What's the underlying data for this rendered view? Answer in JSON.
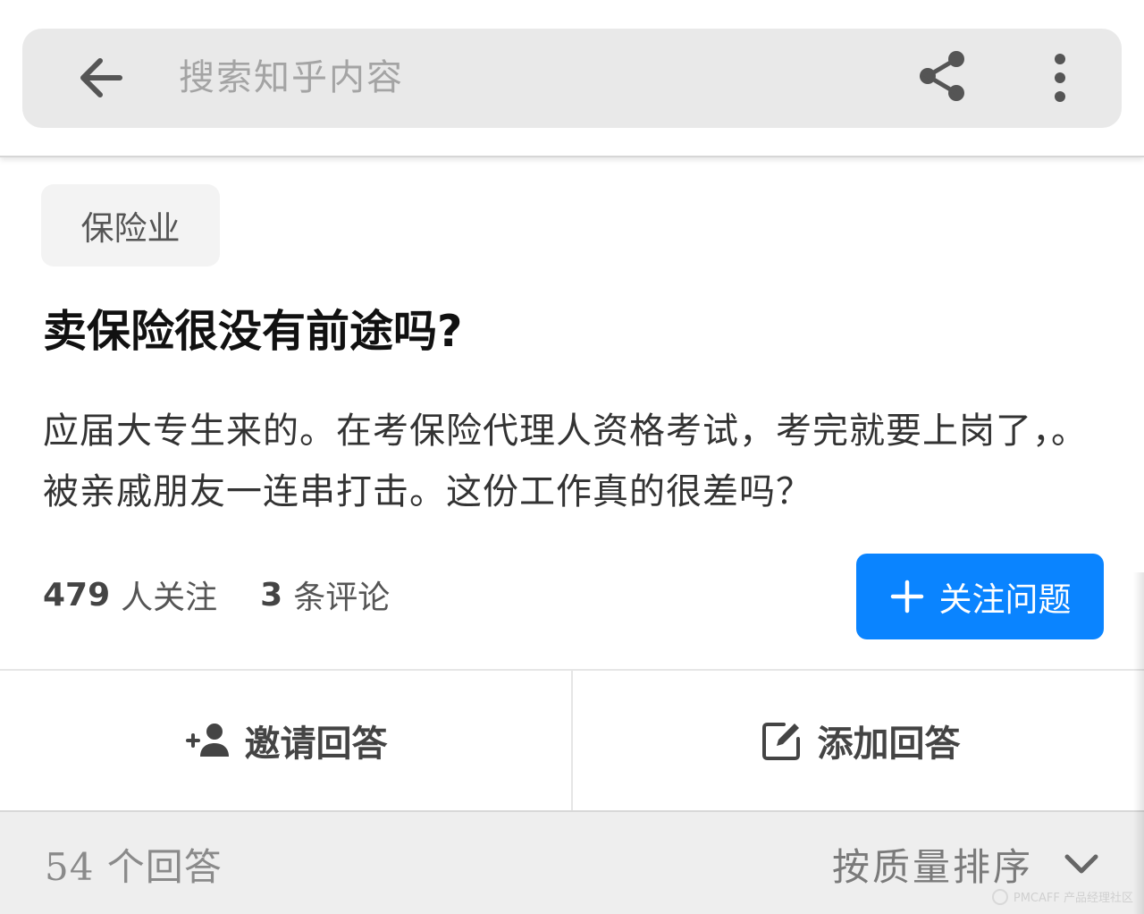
{
  "search": {
    "placeholder": "搜索知乎内容"
  },
  "icons": {
    "back": "arrow-back-icon",
    "share": "share-icon",
    "more": "more-vertical-icon",
    "follow": "plus-icon",
    "invite": "person-add-icon",
    "add_answer": "edit-icon",
    "sort": "chevron-down-icon"
  },
  "question": {
    "topic": "保险业",
    "title": "卖保险很没有前途吗?",
    "detail": "应届大专生来的。在考保险代理人资格考试，考完就要上岗了，。被亲戚朋友一连串打击。这份工作真的很差吗？",
    "followers_count": "479",
    "followers_label": "人关注",
    "comments_count": "3",
    "comments_label": "条评论",
    "follow_button": "关注问题"
  },
  "actions": {
    "invite_label": "邀请回答",
    "add_answer_label": "添加回答"
  },
  "answers": {
    "count_label": "54 个回答",
    "sort_label": "按质量排序"
  },
  "watermark": {
    "text": "PMCAFF 产品经理社区"
  },
  "colors": {
    "accent": "#0a84ff",
    "search_bg": "#e9e9e9",
    "tag_bg": "#f3f3f3",
    "answers_bar_bg": "#eeeeee"
  }
}
